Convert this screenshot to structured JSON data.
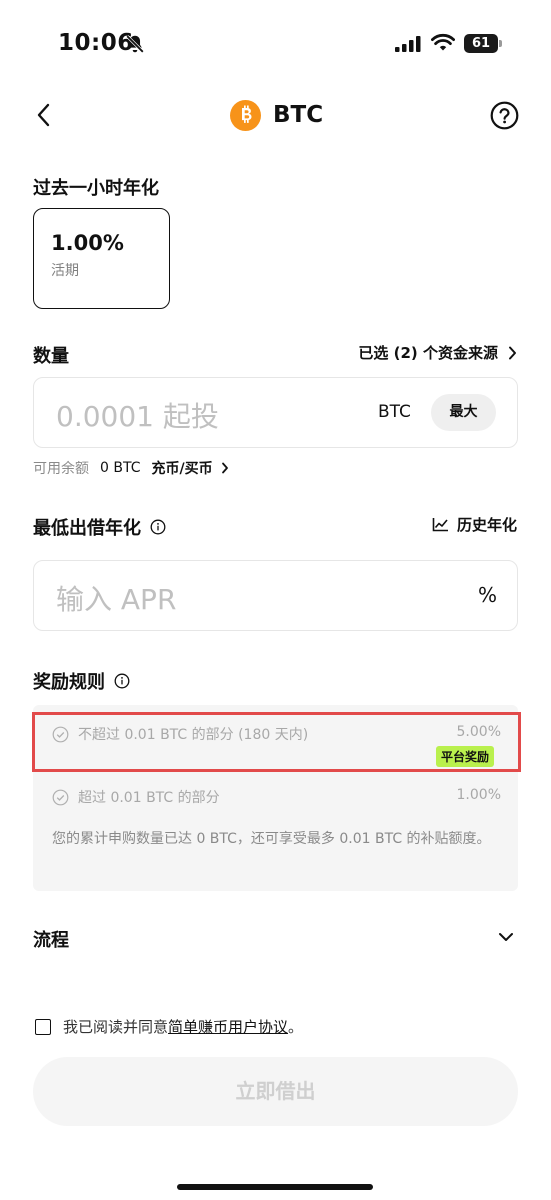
{
  "status_bar": {
    "time": "10:06",
    "battery": "61"
  },
  "header": {
    "title": "BTC",
    "coin_icon": "bitcoin-icon"
  },
  "term": {
    "label": "过去一小时年化",
    "rate": "1.00%",
    "type": "活期"
  },
  "amount": {
    "label": "数量",
    "sources": "已选 (2) 个资金来源",
    "placeholder": "0.0001 起投",
    "unit": "BTC",
    "max_label": "最大",
    "balance_label": "可用余额",
    "balance_value": "0 BTC",
    "deposit_link": "充币/买币"
  },
  "apr": {
    "label": "最低出借年化",
    "history_link": "历史年化",
    "placeholder": "输入 APR",
    "unit": "%"
  },
  "rules": {
    "label": "奖励规则",
    "tiers": [
      {
        "text": "不超过 0.01 BTC 的部分 (180 天内)",
        "rate": "5.00%",
        "badge": "平台奖励"
      },
      {
        "text": "超过 0.01 BTC 的部分",
        "rate": "1.00%"
      }
    ],
    "note": "您的累计申购数量已达 0 BTC，还可享受最多 0.01 BTC 的补贴额度。"
  },
  "process": {
    "label": "流程"
  },
  "agreement": {
    "prefix": "我已阅读并同意",
    "link": "简单赚币用户协议",
    "suffix": "。"
  },
  "submit_label": "立即借出",
  "colors": {
    "accent_orange": "#f7931a",
    "highlight_red": "#e24a4a",
    "badge_green": "#b9f04d",
    "panel_bg": "#f5f5f5"
  }
}
